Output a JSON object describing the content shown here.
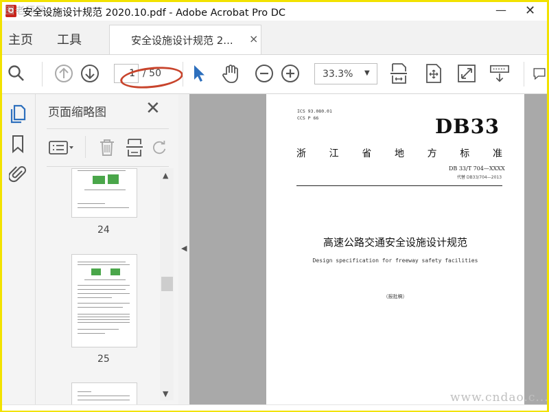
{
  "window": {
    "title": "安全设施设计规范 2020.10.pdf - Adobe Acrobat Pro DC",
    "minimize_glyph": "—",
    "close_glyph": "✕",
    "watermark_top": "图老师网"
  },
  "tabs": {
    "home": "主页",
    "tools": "工具",
    "document": "安全设施设计规范 2...",
    "close_glyph": "×"
  },
  "toolbar": {
    "current_page": "1",
    "total_pages": "/ 50",
    "zoom": "33.3%",
    "zoom_caret": "▼",
    "icons": [
      "search-icon",
      "page-up-icon",
      "page-down-icon",
      "select-cursor-icon",
      "hand-tool-icon",
      "zoom-out-icon",
      "zoom-in-icon",
      "fit-page-icon",
      "rotate-view-icon",
      "full-screen-icon",
      "scroll-mode-icon",
      "comment-icon"
    ]
  },
  "sidebar": {
    "title": "页面缩略图",
    "close_glyph": "✕",
    "pages": [
      {
        "number": "24"
      },
      {
        "number": "25"
      }
    ],
    "scroll_up": "▲",
    "scroll_down": "▼",
    "collapse_glyph": "◀"
  },
  "document_page": {
    "ics_line1": "ICS 93.080.01",
    "ics_line2": "CCS P 66",
    "code": "DB33",
    "standard_chars": [
      "浙",
      "江",
      "省",
      "地",
      "方",
      "标",
      "准"
    ],
    "number": "DB 33/T 704—XXXX",
    "replaces": "代替 DB33/704—2013",
    "title_cn": "高速公路交通安全设施设计规范",
    "title_en": "Design specification for freeway safety facilities",
    "draft": "（报批稿）"
  },
  "footer": {
    "watermark_bottom": "www.cndao.c..."
  },
  "colors": {
    "accent_blue": "#2d6fbd",
    "annotation_red": "#c8442c",
    "frame_yellow": "#f2e200",
    "canvas_gray": "#a9a9a9"
  }
}
